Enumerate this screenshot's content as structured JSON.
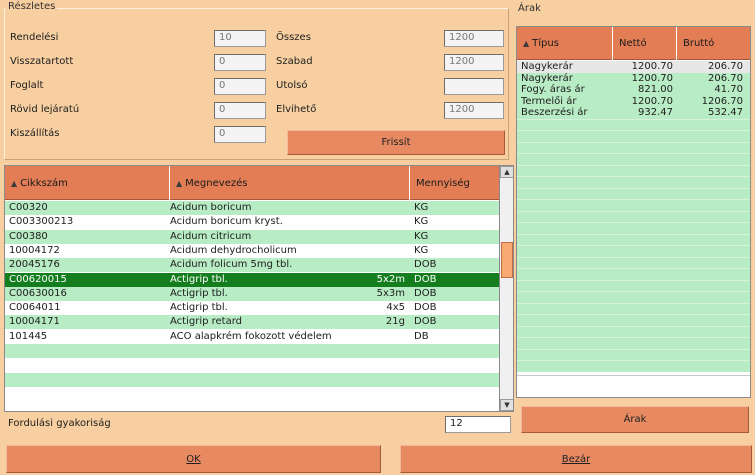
{
  "details": {
    "title": "Részletes",
    "left_fields": [
      {
        "label": "Rendelési",
        "value": "10"
      },
      {
        "label": "Visszatartott",
        "value": "0"
      },
      {
        "label": "Foglalt",
        "value": "0"
      },
      {
        "label": "Rövid lejáratú",
        "value": "0"
      },
      {
        "label": "Kiszállítás",
        "value": "0"
      }
    ],
    "right_fields": [
      {
        "label": "Összes",
        "value": "1200"
      },
      {
        "label": "Szabad",
        "value": "1200"
      },
      {
        "label": "Utolsó",
        "value": ""
      },
      {
        "label": "Elvihető",
        "value": "1200"
      }
    ],
    "action_button": "Frissít"
  },
  "products": {
    "columns": [
      "Cikkszám",
      "Megnevezés",
      "Mennyiség"
    ],
    "rows": [
      {
        "code": "C00320",
        "name": "Acidum boricum",
        "qty": "",
        "unit": "KG",
        "style": "green"
      },
      {
        "code": "C003300213",
        "name": "Acidum boricum kryst.",
        "qty": "",
        "unit": "KG",
        "style": "white"
      },
      {
        "code": "C00380",
        "name": "Acidum citricum",
        "qty": "",
        "unit": "KG",
        "style": "green"
      },
      {
        "code": "10004172",
        "name": "Acidum dehydrocholicum",
        "qty": "",
        "unit": "KG",
        "style": "white"
      },
      {
        "code": "20045176",
        "name": "Acidum folicum 5mg tbl.",
        "qty": "",
        "unit": "DOB",
        "style": "green"
      },
      {
        "code": "C00620015",
        "name": "Actigrip tbl.",
        "qty": "5x2m",
        "unit": "DOB",
        "style": "sel"
      },
      {
        "code": "C00630016",
        "name": "Actigrip tbl.",
        "qty": "5x3m",
        "unit": "DOB",
        "style": "green"
      },
      {
        "code": "C0064011",
        "name": "Actigrip tbl.",
        "qty": "4x5",
        "unit": "DOB",
        "style": "white"
      },
      {
        "code": "10004171",
        "name": "Actigrip retard",
        "qty": "21g",
        "unit": "DOB",
        "style": "green"
      },
      {
        "code": "101445",
        "name": "ACO alapkrém fokozott védelem",
        "qty": "",
        "unit": "DB",
        "style": "white"
      }
    ]
  },
  "filter": {
    "label": "Fordulási gyakoriság",
    "value": "12"
  },
  "buttons": {
    "ok": "OK",
    "cancel": "Bezár"
  },
  "prices": {
    "title": "Árak",
    "columns": [
      "Típus",
      "Nettó",
      "Bruttó"
    ],
    "rows": [
      {
        "type": "Nagykerár",
        "net": "1200.70",
        "gross": "206.70",
        "style": "gray"
      },
      {
        "type": "Nagykerár",
        "net": "1200.70",
        "gross": "206.70",
        "style": "green"
      },
      {
        "type": "Fogy. áras ár",
        "net": "821.00",
        "gross": "41.70",
        "style": "green"
      },
      {
        "type": "Termelői ár",
        "net": "1200.70",
        "gross": "1206.70",
        "style": "green"
      },
      {
        "type": "Beszerzési ár",
        "net": "932.47",
        "gross": "532.47",
        "style": "green"
      }
    ],
    "action_button": "Árak"
  }
}
